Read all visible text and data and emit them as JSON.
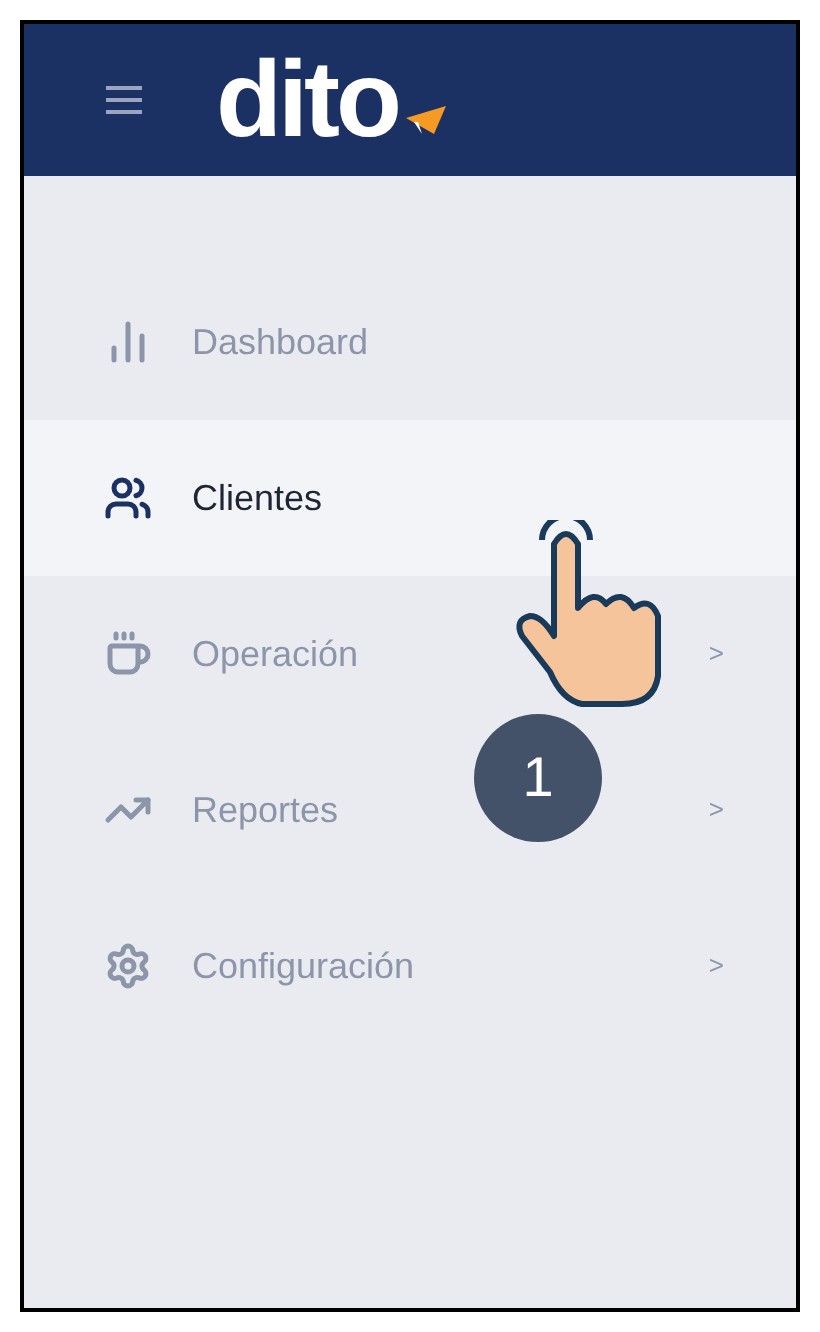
{
  "header": {
    "logo": "dito"
  },
  "menu": [
    {
      "label": "Dashboard",
      "selected": false
    },
    {
      "label": "Clientes",
      "selected": true
    },
    {
      "label": "Operación",
      "selected": false,
      "chevron": ">"
    },
    {
      "label": "Reportes",
      "selected": false,
      "chevron": ">"
    },
    {
      "label": "Configuración",
      "selected": false,
      "chevron": ">"
    }
  ],
  "step_badge": "1"
}
